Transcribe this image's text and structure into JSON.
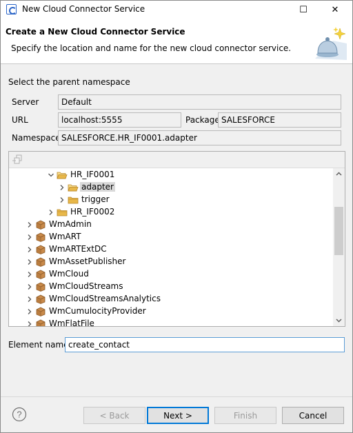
{
  "window": {
    "title": "New Cloud Connector Service",
    "minimize_glyph": "—",
    "maximize_glyph": "☐",
    "close_glyph": "✕"
  },
  "banner": {
    "title": "Create a New Cloud Connector Service",
    "description": "Specify the location and name for the new cloud connector service."
  },
  "form": {
    "section_label": "Select the parent namespace",
    "server_label": "Server",
    "server_value": "Default",
    "url_label": "URL",
    "url_value": "localhost:5555",
    "package_label": "Package",
    "package_value": "SALESFORCE",
    "namespace_label": "Namespace",
    "namespace_value": "SALESFORCE.HR_IF0001.adapter"
  },
  "tree": {
    "rows": [
      {
        "label": "HR_IF0001",
        "icon": "open-folder-icon",
        "twisty": "expanded",
        "selected": false
      },
      {
        "label": "adapter",
        "icon": "open-folder-icon",
        "twisty": "collapsed",
        "selected": true
      },
      {
        "label": "trigger",
        "icon": "folder-icon",
        "twisty": "collapsed",
        "selected": false
      },
      {
        "label": "HR_IF0002",
        "icon": "folder-icon",
        "twisty": "collapsed",
        "selected": false
      },
      {
        "label": "WmAdmin",
        "icon": "package-icon",
        "twisty": "collapsed",
        "selected": false
      },
      {
        "label": "WmART",
        "icon": "package-icon",
        "twisty": "collapsed",
        "selected": false
      },
      {
        "label": "WmARTExtDC",
        "icon": "package-icon",
        "twisty": "collapsed",
        "selected": false
      },
      {
        "label": "WmAssetPublisher",
        "icon": "package-icon",
        "twisty": "collapsed",
        "selected": false
      },
      {
        "label": "WmCloud",
        "icon": "package-icon",
        "twisty": "collapsed",
        "selected": false
      },
      {
        "label": "WmCloudStreams",
        "icon": "package-icon",
        "twisty": "collapsed",
        "selected": false
      },
      {
        "label": "WmCloudStreamsAnalytics",
        "icon": "package-icon",
        "twisty": "collapsed",
        "selected": false
      },
      {
        "label": "WmCumulocityProvider",
        "icon": "package-icon",
        "twisty": "collapsed",
        "selected": false
      },
      {
        "label": "WmFlatFile",
        "icon": "package-icon",
        "twisty": "collapsed",
        "selected": false
      }
    ]
  },
  "element": {
    "label": "Element name",
    "value": "create_contact"
  },
  "footer": {
    "help_glyph": "?",
    "back_label": "< Back",
    "next_label": "Next >",
    "finish_label": "Finish",
    "cancel_label": "Cancel"
  },
  "colors": {
    "folder": "#e8b84a",
    "package": "#c98a4a",
    "selection": "#d9d9d9",
    "focus_border": "#0078d7"
  }
}
